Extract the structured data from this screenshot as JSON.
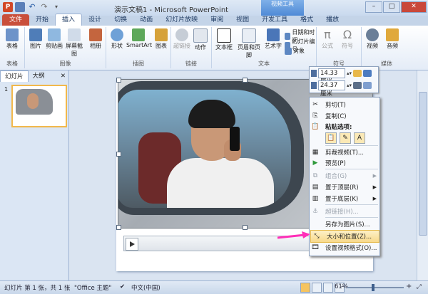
{
  "window": {
    "title": "演示文稿1 - Microsoft PowerPoint",
    "context_group": "视频工具",
    "app_logo": "P",
    "controls": {
      "minimize": "–",
      "maximize": "□",
      "close": "✕"
    }
  },
  "tabs": [
    "开始",
    "插入",
    "设计",
    "切换",
    "动画",
    "幻灯片放映",
    "审阅",
    "视图",
    "开发工具",
    "格式",
    "播放"
  ],
  "file_tab": "文件",
  "ribbon": {
    "groups": [
      {
        "label": "表格",
        "buttons": [
          "表格"
        ]
      },
      {
        "label": "图像",
        "buttons": [
          "图片",
          "剪贴画",
          "屏幕截图",
          "相册"
        ]
      },
      {
        "label": "插图",
        "buttons": [
          "形状",
          "SmartArt",
          "图表"
        ]
      },
      {
        "label": "链接",
        "buttons": [
          "超链接",
          "动作"
        ]
      },
      {
        "label": "文本",
        "buttons": [
          "文本框",
          "页眉和页脚",
          "艺术字"
        ]
      },
      {
        "label": "符号",
        "buttons": [
          "公式",
          "符号"
        ]
      },
      {
        "label": "媒体",
        "buttons": [
          "视频",
          "音频"
        ]
      }
    ],
    "text_small": [
      "日期和时间",
      "幻灯片编号",
      "对象"
    ]
  },
  "slide_panel": {
    "tabs": [
      "幻灯片",
      "大纲"
    ],
    "close": "✕",
    "slide_number": "1"
  },
  "size_tip": {
    "height": "14.33 厘米",
    "width": "24.37 厘米"
  },
  "context_menu": {
    "items": [
      {
        "label": "剪切(T)",
        "icon": "✂",
        "disabled": false
      },
      {
        "label": "复制(C)",
        "icon": "⎘",
        "disabled": false
      },
      {
        "label": "粘贴选项:",
        "icon": "📋",
        "disabled": false,
        "bold": true
      },
      {
        "label": "剪裁视频(T)...",
        "icon": "▦",
        "disabled": false
      },
      {
        "label": "预览(P)",
        "icon": "▶",
        "disabled": false
      },
      {
        "label": "组合(G)",
        "icon": "⧉",
        "disabled": true,
        "submenu": true
      },
      {
        "label": "置于顶层(R)",
        "icon": "▤",
        "disabled": false,
        "submenu": true
      },
      {
        "label": "置于底层(K)",
        "icon": "▥",
        "disabled": false,
        "submenu": true
      },
      {
        "label": "超链接(H)...",
        "icon": "⚓",
        "disabled": true
      },
      {
        "label": "另存为图片(S)...",
        "icon": "",
        "disabled": false
      },
      {
        "label": "大小和位置(Z)...",
        "icon": "⤡",
        "disabled": false,
        "highlight": true
      },
      {
        "label": "设置视频格式(O)...",
        "icon": "🎞",
        "disabled": false
      }
    ],
    "paste_icons": [
      "📋",
      "✎",
      "A"
    ]
  },
  "status": {
    "slide": "幻灯片 第 1 张，共 1 张",
    "theme": "\"Office 主题\"",
    "language": "中文(中国)",
    "zoom": "61%",
    "minus": "–",
    "plus": "+"
  }
}
